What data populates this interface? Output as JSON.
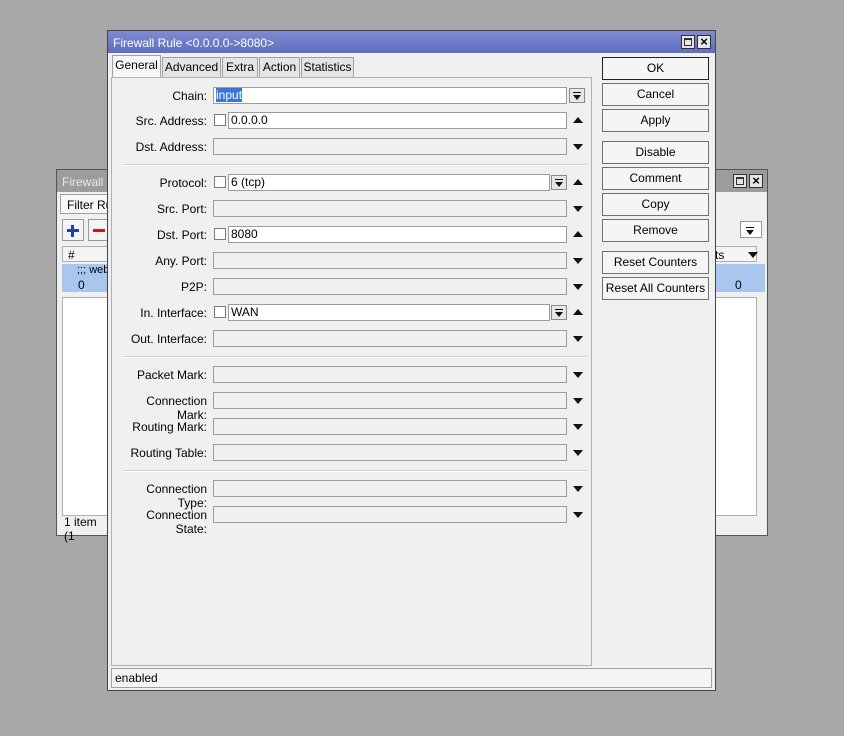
{
  "bg_window": {
    "title": "Firewall",
    "tab_label": "Filter Rul",
    "col_num": "#",
    "col_right": "ts",
    "row_comment": ";;; web",
    "row_num": "0",
    "row_right_value": "0",
    "status": "1 item (1"
  },
  "dialog": {
    "title": "Firewall Rule <0.0.0.0->8080>",
    "tabs": [
      "General",
      "Advanced",
      "Extra",
      "Action",
      "Statistics"
    ],
    "fields": {
      "chain": {
        "label": "Chain:",
        "value": "input"
      },
      "src_address": {
        "label": "Src. Address:",
        "value": "0.0.0.0"
      },
      "dst_address": {
        "label": "Dst. Address:",
        "value": ""
      },
      "protocol": {
        "label": "Protocol:",
        "value": "6 (tcp)"
      },
      "src_port": {
        "label": "Src. Port:",
        "value": ""
      },
      "dst_port": {
        "label": "Dst. Port:",
        "value": "8080"
      },
      "any_port": {
        "label": "Any. Port:",
        "value": ""
      },
      "p2p": {
        "label": "P2P:",
        "value": ""
      },
      "in_interface": {
        "label": "In. Interface:",
        "value": "WAN"
      },
      "out_interface": {
        "label": "Out. Interface:",
        "value": ""
      },
      "packet_mark": {
        "label": "Packet Mark:",
        "value": ""
      },
      "connection_mark": {
        "label": "Connection Mark:",
        "value": ""
      },
      "routing_mark": {
        "label": "Routing Mark:",
        "value": ""
      },
      "routing_table": {
        "label": "Routing Table:",
        "value": ""
      },
      "connection_type": {
        "label": "Connection Type:",
        "value": ""
      },
      "connection_state": {
        "label": "Connection State:",
        "value": ""
      }
    },
    "buttons": {
      "ok": "OK",
      "cancel": "Cancel",
      "apply": "Apply",
      "disable": "Disable",
      "comment": "Comment",
      "copy": "Copy",
      "remove": "Remove",
      "reset_counters": "Reset Counters",
      "reset_all_counters": "Reset All Counters"
    },
    "status": "enabled"
  },
  "colors": {
    "title_active": "#6b78c6",
    "title_inactive": "#9c9c9c",
    "selection": "#3a76d6",
    "row_highlight": "#a9c6ee"
  }
}
